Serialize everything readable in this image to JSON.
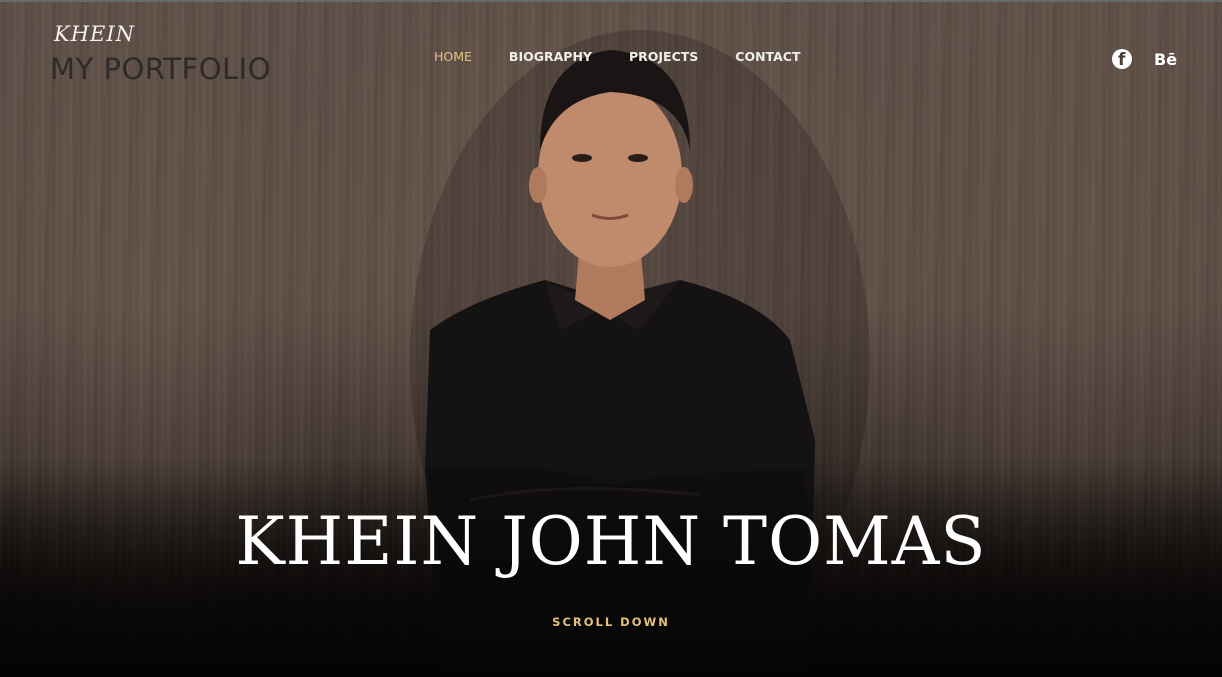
{
  "header": {
    "logo_script": "KHEIN",
    "logo_title": "MY PORTFOLIO"
  },
  "nav": {
    "items": [
      {
        "label": "HOME",
        "active": true
      },
      {
        "label": "BIOGRAPHY",
        "active": false
      },
      {
        "label": "PROJECTS",
        "active": false
      },
      {
        "label": "CONTACT",
        "active": false
      }
    ]
  },
  "social": {
    "facebook_icon": "facebook-icon",
    "behance_label": "Bē"
  },
  "hero": {
    "title": "KHEIN JOHN TOMAS",
    "scroll_label": "SCROLL DOWN"
  },
  "colors": {
    "accent": "#e4c27c",
    "text_light": "#f2efe9",
    "logo_dark": "#2d2a29"
  }
}
